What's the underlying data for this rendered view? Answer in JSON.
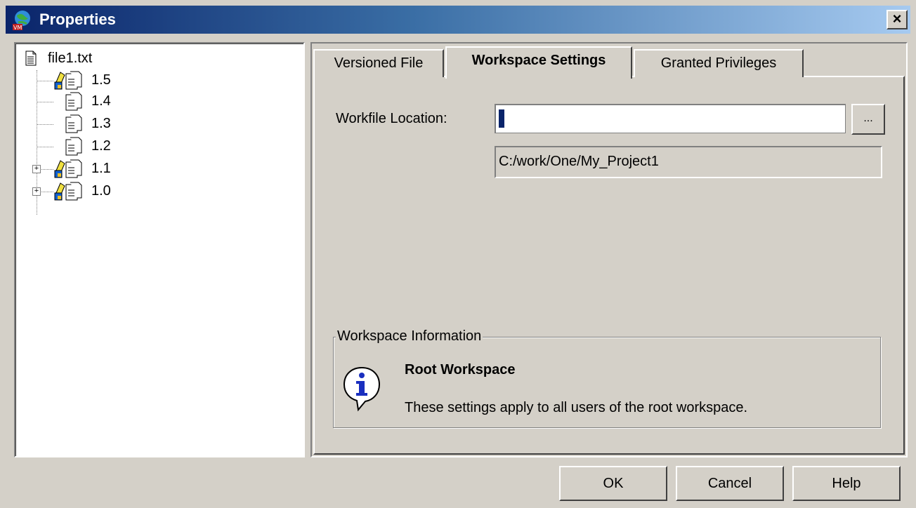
{
  "window": {
    "title": "Properties",
    "close_symbol": "×"
  },
  "tree": {
    "root": {
      "label": "file1.txt",
      "icon": "document-icon"
    },
    "items": [
      {
        "label": "1.5",
        "icon": "labeled-revision-icon",
        "expandable": false
      },
      {
        "label": "1.4",
        "icon": "revision-icon",
        "expandable": false
      },
      {
        "label": "1.3",
        "icon": "revision-icon",
        "expandable": false
      },
      {
        "label": "1.2",
        "icon": "revision-icon",
        "expandable": false
      },
      {
        "label": "1.1",
        "icon": "labeled-revision-icon",
        "expandable": true
      },
      {
        "label": "1.0",
        "icon": "labeled-revision-icon",
        "expandable": true
      }
    ],
    "expander_symbol": "+"
  },
  "tabs": [
    {
      "label": "Versioned File",
      "active": false
    },
    {
      "label": "Workspace Settings",
      "active": true
    },
    {
      "label": "Granted Privileges",
      "active": false
    }
  ],
  "workspace_settings": {
    "workfile_location_label": "Workfile Location:",
    "workfile_location_value": "",
    "browse_label": "...",
    "resolved_path": "C:/work/One/My_Project1",
    "info_group_title": "Workspace Information",
    "info_title": "Root Workspace",
    "info_text": "These settings apply to all users of the root workspace."
  },
  "buttons": {
    "ok": "OK",
    "cancel": "Cancel",
    "help": "Help"
  },
  "colors": {
    "titlebar_start": "#0a246a",
    "titlebar_end": "#a6caf0",
    "face": "#d4d0c8",
    "caret": "#0a246a"
  }
}
